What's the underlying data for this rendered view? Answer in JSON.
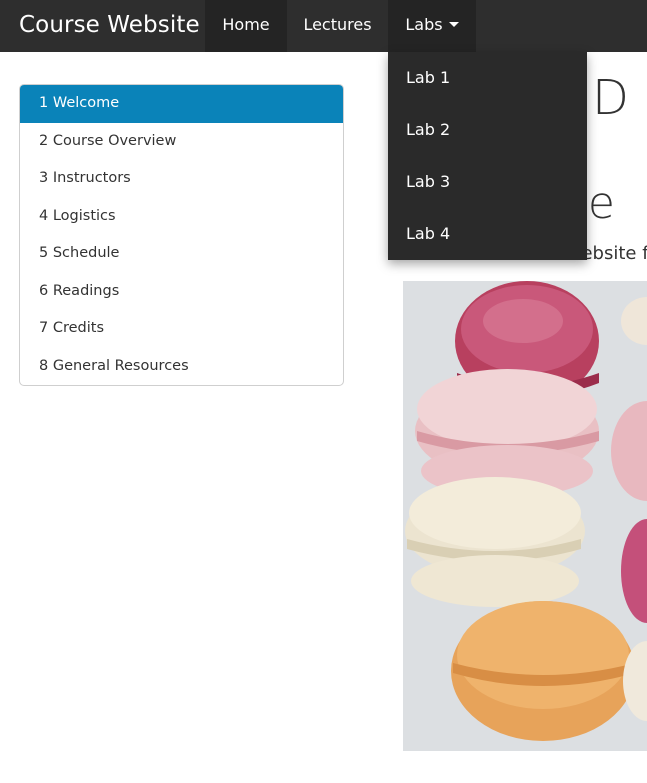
{
  "navbar": {
    "brand": "Course Website",
    "items": [
      {
        "label": "Home"
      },
      {
        "label": "Lectures"
      },
      {
        "label": "Labs"
      }
    ],
    "labs_menu": [
      "Lab 1",
      "Lab 2",
      "Lab 3",
      "Lab 4"
    ],
    "colors": {
      "background": "#2e2e2e",
      "active": "#242424"
    }
  },
  "toc": {
    "items": [
      {
        "label": "1 Welcome",
        "active": true
      },
      {
        "label": "2 Course Overview"
      },
      {
        "label": "3 Instructors"
      },
      {
        "label": "4 Logistics"
      },
      {
        "label": "5 Schedule"
      },
      {
        "label": "6 Readings"
      },
      {
        "label": "7 Credits"
      },
      {
        "label": "8 General Resources"
      }
    ],
    "active_color": "#0a83b9"
  },
  "main": {
    "title_fragment": "D",
    "section_fragment": "ne",
    "intro_fragment": "This is the course website fo"
  }
}
